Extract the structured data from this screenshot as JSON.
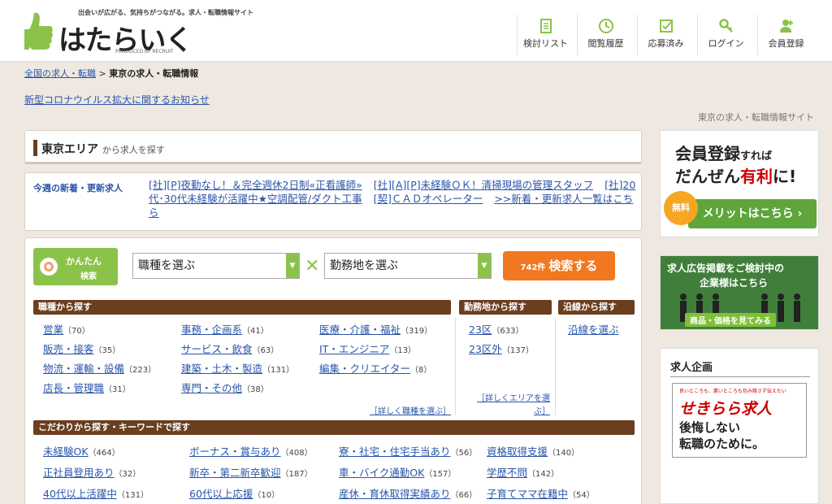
{
  "header": {
    "tagline": "出会いが広がる、気持ちがつながる。求人・転職情報サイト",
    "logo_text": "はたらいく",
    "produced_by": "PRODUCED BY RECRUIT",
    "nav": [
      {
        "label": "検討リスト",
        "icon": "clipboard-icon"
      },
      {
        "label": "閲覧履歴",
        "icon": "clock-icon"
      },
      {
        "label": "応募済み",
        "icon": "checkbox-icon"
      },
      {
        "label": "ログイン",
        "icon": "key-icon"
      },
      {
        "label": "会員登録",
        "icon": "user-plus-icon"
      }
    ]
  },
  "breadcrumb": {
    "home": "全国の求人・転職",
    "sep": ">",
    "current": "東京の求人・転職情報"
  },
  "notice": "新型コロナウイルス拡大に関するお知らせ",
  "site_label": "東京の求人・転職情報サイト",
  "area": {
    "title": "東京エリア",
    "subtitle": "から求人を探す"
  },
  "new_jobs": {
    "label": "今週の新着・更新求人",
    "items": [
      "[社][P]夜勤なし！＆完全週休2日制«正看護師»",
      "[社][A][P]未経験ＯＫ！清掃現場の管理スタッフ",
      "[社]20代･30代未経験が活躍中★空調配管/ダクト工事",
      "[契]ＣＡＤオペレーター",
      ">>新着・更新求人一覧はこちら"
    ]
  },
  "search": {
    "easy_label1": "かんたん",
    "easy_label2": "検索",
    "job_select": "職種を選ぶ",
    "area_select": "勤務地を選ぶ",
    "count": "742件",
    "go_label": "検索する"
  },
  "job_types": {
    "header": "職種から探す",
    "items": [
      {
        "label": "営業",
        "count": "（70）"
      },
      {
        "label": "販売・接客",
        "count": "（35）"
      },
      {
        "label": "物流・運輸・設備",
        "count": "（223）"
      },
      {
        "label": "店長・管理職",
        "count": "（31）"
      },
      {
        "label": "事務・企画系",
        "count": "（41）"
      },
      {
        "label": "サービス・飲食",
        "count": "（63）"
      },
      {
        "label": "建築・土木・製造",
        "count": "（131）"
      },
      {
        "label": "専門・その他",
        "count": "（38）"
      },
      {
        "label": "医療・介護・福祉",
        "count": "（319）"
      },
      {
        "label": "IT・エンジニア",
        "count": "（13）"
      },
      {
        "label": "編集・クリエイター",
        "count": "（8）"
      }
    ],
    "detail": "［詳しく職種を選ぶ］"
  },
  "work_area": {
    "header": "勤務地から探す",
    "items": [
      {
        "label": "23区",
        "count": "（633）"
      },
      {
        "label": "23区外",
        "count": "（137）"
      }
    ],
    "detail1": "［詳しくエリアを選",
    "detail2": "ぶ］"
  },
  "line": {
    "header": "沿線から探す",
    "link": "沿線を選ぶ"
  },
  "keywords": {
    "header": "こだわりから探す・キーワードで探す",
    "items": [
      {
        "label": "未経験OK",
        "count": "（464）"
      },
      {
        "label": "ボーナス・賞与あり",
        "count": "（408）"
      },
      {
        "label": "寮・社宅・住宅手当あり",
        "count": "（56）"
      },
      {
        "label": "資格取得支援",
        "count": "（140）"
      },
      {
        "label": "正社員登用あり",
        "count": "（32）"
      },
      {
        "label": "新卒・第二新卒歓迎",
        "count": "（187）"
      },
      {
        "label": "車・バイク通勤OK",
        "count": "（157）"
      },
      {
        "label": "学歴不問",
        "count": "（142）"
      },
      {
        "label": "40代以上活躍中",
        "count": "（131）"
      },
      {
        "label": "60代以上応援",
        "count": "（10）"
      },
      {
        "label": "産休・育休取得実績あり",
        "count": "（66）"
      },
      {
        "label": "子育てママ在籍中",
        "count": "（54）"
      }
    ]
  },
  "sidebar": {
    "member_ad": {
      "line1": "会員登録",
      "line1b": "すれば",
      "line2a": "だんぜん",
      "line2b": "有利",
      "line2c": "に!",
      "free": "無料",
      "button": "メリットはこちら ›"
    },
    "company_ad": {
      "line1": "求人広告掲載をご検討中の",
      "line2": "企業様はこちら",
      "button": "商品・価格を見てみる"
    },
    "plan": {
      "header": "求人企画",
      "small": "良いところも、悪いところも包み隠さず伝えたい",
      "brand": "せきらら求人",
      "copy1": "後悔しない",
      "copy2": "転職のために。"
    }
  },
  "colors": {
    "accent_green": "#8bc34a",
    "brown": "#6b3e1f",
    "orange": "#f07820",
    "link": "#2a55a8"
  }
}
